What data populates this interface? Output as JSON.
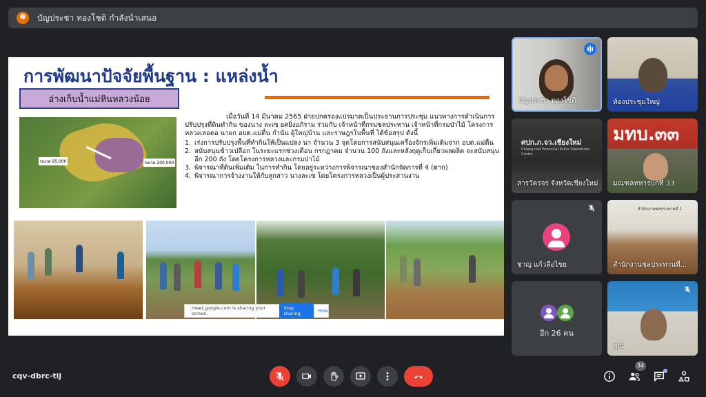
{
  "topbar": {
    "presenter_text": "บัญประชา ทองโชติ กำลังนำเสนอ"
  },
  "slide": {
    "title": "การพัฒนาปัจจัยพื้นฐาน : แหล่งน้ำ",
    "subhead": "อ่างเก็บน้ำแม่หินหลวงน้อย",
    "map_labels": [
      "ขนาด 95,000",
      "ขนาด 200,000"
    ],
    "paragraph": "เมื่อวันที่ 14 มีนาคม 2565 ฝ่ายปกครองแปรมาตเป็นประธานการประชุม แนวทางการดำเนินการปรับปรุงที่ดินทำกิน ของนาง ละเซ ยศยิ่งอภิราม ร่วมกับ เจ้าหน้าที่กรมชลประทาน เจ้าหน้าที่กรมป่าไม้ โครงการหลวงเลอตอ นายก อบต.แม่ตื่น กำนัน ผู้ใหญ่บ้าน และราษฎรในพื้นที่ ได้ข้อสรุป ดังนี้",
    "items": [
      {
        "num": "1.",
        "text": "เร่งการปรับปรุงพื้นที่ทำกินให้เป็นแปลง นา จำนวน 3 จุดโดยการสนับสนุนเครื่องจักรเพิ่มเติมจาก อบต.แม่ตื่น"
      },
      {
        "num": "2.",
        "text": "สนับสนุนข้าวเปลือก ในระยะแรกช่วงเดือน กรกฎาคม จำนวน 100 ถังและหลังฤดูเก็บเกี่ยวผลผลิต จะสนับสนุนอีก 200 ถัง โดยโครงการหลวงและกรมป่าไม้"
      },
      {
        "num": "3.",
        "text": "พิจารณาที่ดินเพิ่มเติม ในการทำกิน โดยอยู่ระหว่างการพิจารณาของสำนักจัดการที่ 4 (ตาก)"
      },
      {
        "num": "4.",
        "text": "พิจารณาการจ้างงานให้กับลูกสาว นางละเซ โดยโครงการหลวงเป็นผู้ประสานงาน"
      }
    ]
  },
  "share_bar": {
    "message": "meet.google.com is sharing your screen.",
    "stop_label": "Stop sharing",
    "hide_label": "Hide"
  },
  "participants": [
    {
      "name": "บัญประชา ทองโชติ"
    },
    {
      "name": "ห้องประชุมใหญ่"
    },
    {
      "name": "สารวัตรจร จังหวัดเชียงใหม่"
    },
    {
      "name": "มณฑลทหารบกที่ 33"
    },
    {
      "name": "ชาญ แก้วลือไชย"
    },
    {
      "name": "สำนักงานชลประทานที่..."
    },
    {
      "name": "อีก 26 คน"
    },
    {
      "name": "คุณ"
    }
  ],
  "tile_text": {
    "police_sign_th": "ศปก.ภ.จว.เชียงใหม่",
    "police_sign_en": "Chiang mai Provincial Police Operations Center",
    "military_sign": "มทบ.๓๓",
    "office_sign": "สำนักงานชลประทานที่ 1"
  },
  "bottom": {
    "meeting_code": "cqv-dbrc-tij",
    "participant_count": "34"
  },
  "colors": {
    "background": "#202124",
    "surface": "#3c4043",
    "accent_blue": "#1a73e8",
    "end_red": "#ea4335",
    "title_blue": "#1f3a8a",
    "orange_rule": "#e36c09"
  },
  "icons": {
    "mic": "mic-off-icon",
    "camera": "camera-icon",
    "hand": "raise-hand-icon",
    "present": "present-screen-icon",
    "more": "more-options-icon",
    "end": "end-call-icon",
    "info": "info-icon",
    "people": "people-icon",
    "chat": "chat-icon",
    "activities": "activities-icon"
  }
}
